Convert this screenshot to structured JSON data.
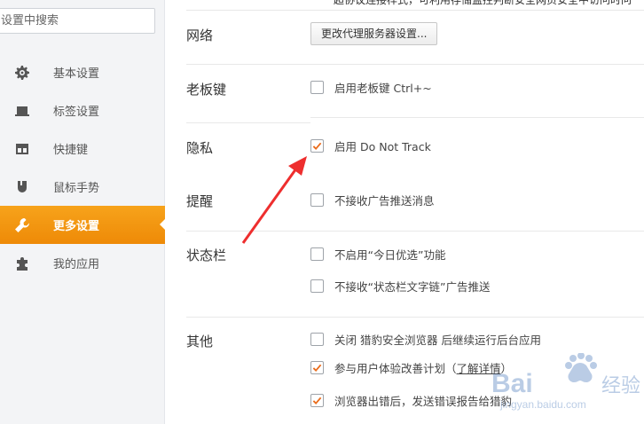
{
  "sidebar": {
    "search_placeholder": "设置中搜索",
    "items": [
      {
        "label": "基本设置",
        "icon": "gear-icon"
      },
      {
        "label": "标签设置",
        "icon": "tab-icon"
      },
      {
        "label": "快捷键",
        "icon": "shortcut-icon"
      },
      {
        "label": "鼠标手势",
        "icon": "mouse-icon"
      },
      {
        "label": "更多设置",
        "icon": "wrench-icon",
        "active": true
      },
      {
        "label": "我的应用",
        "icon": "puzzle-icon"
      }
    ]
  },
  "main": {
    "top_partial_text": "超协议连接样式，可利用存储监控判断安全网页安全中访问时问",
    "network": {
      "title": "网络",
      "proxy_button": "更改代理服务器设置..."
    },
    "boss_key": {
      "title": "老板键",
      "option": "启用老板键  Ctrl+~",
      "checked": false
    },
    "privacy": {
      "title": "隐私",
      "option": "启用 Do Not Track",
      "checked": true
    },
    "reminder": {
      "title": "提醒",
      "option": "不接收广告推送消息",
      "checked": false
    },
    "statusbar": {
      "title": "状态栏",
      "options": [
        {
          "text": "不启用“今日优选”功能",
          "checked": false
        },
        {
          "text": "不接收“状态栏文字链”广告推送",
          "checked": false
        }
      ]
    },
    "other": {
      "title": "其他",
      "options": [
        {
          "text": "关闭 猎豹安全浏览器 后继续运行后台应用",
          "checked": false
        },
        {
          "text": "参与用户体验改善计划（",
          "link": "了解详情",
          "suffix": "）",
          "checked": true
        },
        {
          "text": "浏览器出错后，发送错误报告给猎豹",
          "checked": true
        }
      ]
    }
  },
  "watermark": {
    "brand": "Bai",
    "brand2": "经验",
    "domain": "jingyan.baidu.com"
  },
  "colors": {
    "accent": "#f08c0a",
    "check": "#ea6c1c",
    "arrow": "#ee2e2e"
  }
}
